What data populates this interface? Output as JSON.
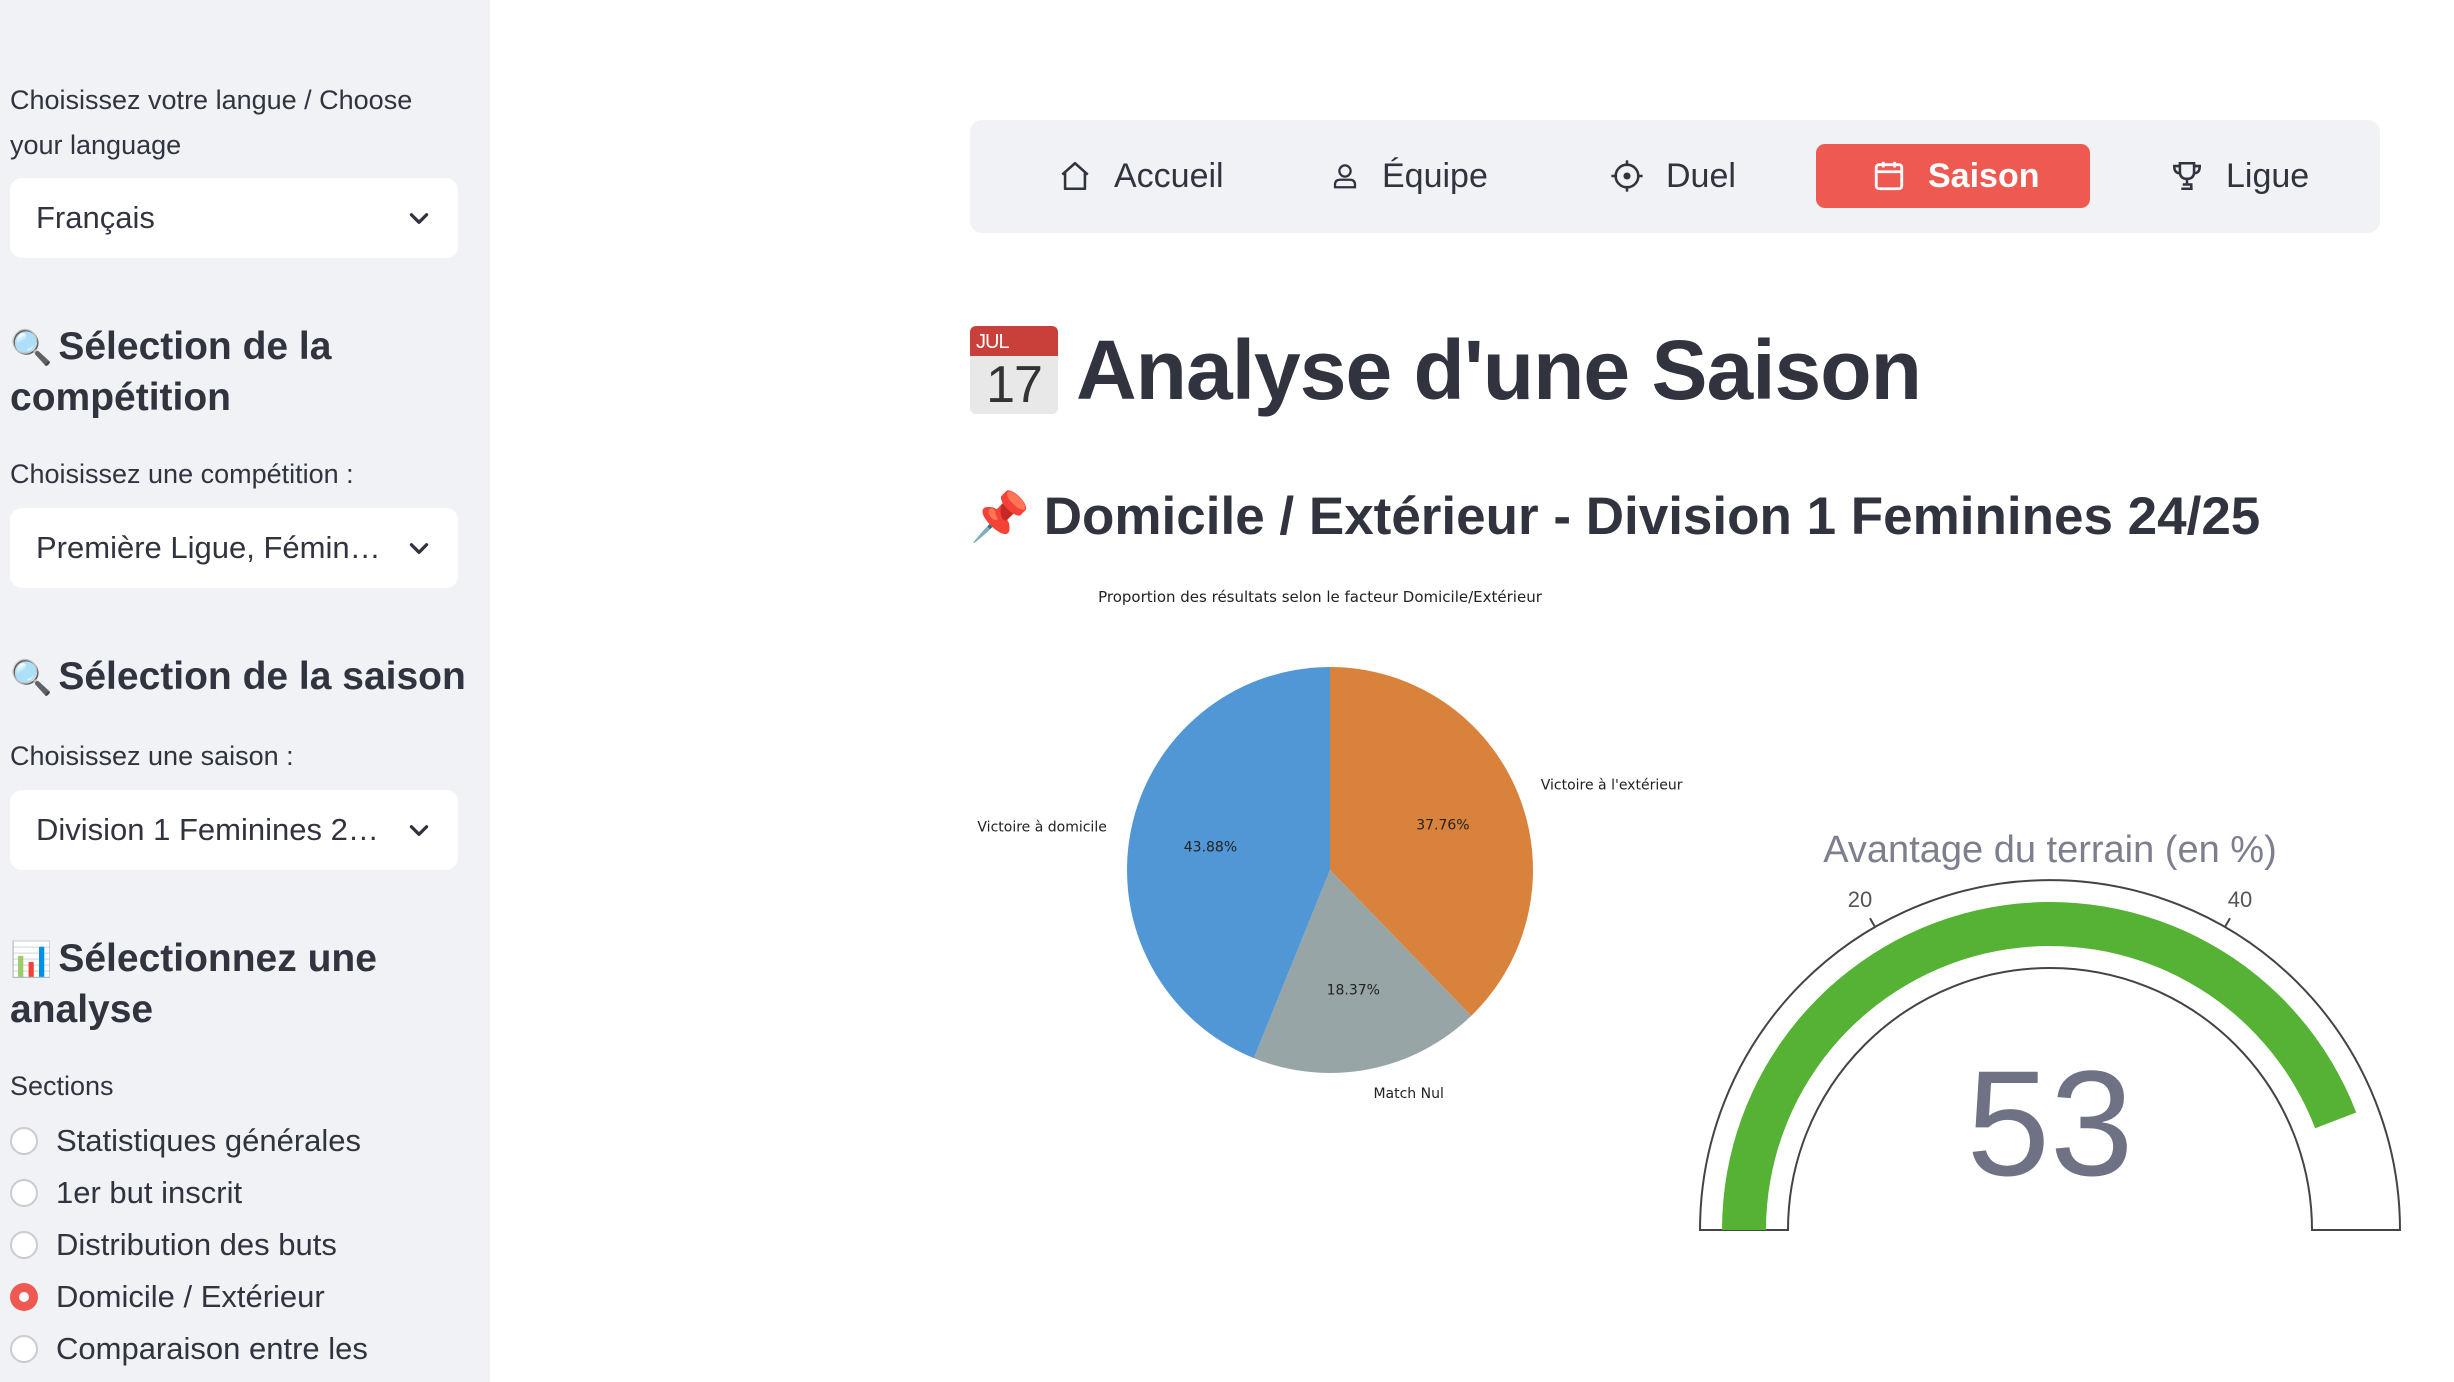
{
  "sidebar": {
    "language_label": "Choisissez votre langue / Choose your language",
    "language_value": "Français",
    "competition_heading": "Sélection de la compétition",
    "competition_label": "Choisissez une compétition :",
    "competition_value": "Première Ligue, Fémin…",
    "season_heading": "Sélection de la saison",
    "season_label": "Choisissez une saison :",
    "season_value": "Division 1 Feminines 2…",
    "analysis_heading": "Sélectionnez une analyse",
    "sections_label": "Sections",
    "sections": [
      {
        "label": "Statistiques générales",
        "selected": false
      },
      {
        "label": "1er but inscrit",
        "selected": false
      },
      {
        "label": "Distribution des buts",
        "selected": false
      },
      {
        "label": "Domicile / Extérieur",
        "selected": true
      },
      {
        "label": "Comparaison entre les",
        "selected": false
      }
    ]
  },
  "nav": {
    "items": [
      {
        "label": "Accueil",
        "icon": "home-icon"
      },
      {
        "label": "Équipe",
        "icon": "user-icon"
      },
      {
        "label": "Duel",
        "icon": "target-icon"
      },
      {
        "label": "Saison",
        "icon": "calendar-icon",
        "active": true
      },
      {
        "label": "Ligue",
        "icon": "trophy-icon"
      }
    ],
    "active_color": "#ee5a52"
  },
  "main": {
    "title_cal_month": "JUL",
    "title_cal_day": "17",
    "title": "Analyse d'une Saison",
    "subtitle": "Domicile / Extérieur - Division 1 Feminines 24/25"
  },
  "chart_data": [
    {
      "type": "pie",
      "title": "Proportion des résultats selon le facteur Domicile/Extérieur",
      "labels": [
        "Victoire à l'extérieur",
        "Match Nul",
        "Victoire à domicile"
      ],
      "values": [
        37.76,
        18.37,
        43.88
      ],
      "value_labels": [
        "37.76%",
        "18.37%",
        "43.88%"
      ],
      "colors": [
        "#d9823b",
        "#98a5a6",
        "#5197d6"
      ]
    },
    {
      "type": "gauge",
      "title": "Avantage du terrain (en %)",
      "value": 53,
      "range": [
        0,
        60
      ],
      "tick_labels": [
        "20",
        "40"
      ],
      "bar_color": "#55b234"
    }
  ]
}
